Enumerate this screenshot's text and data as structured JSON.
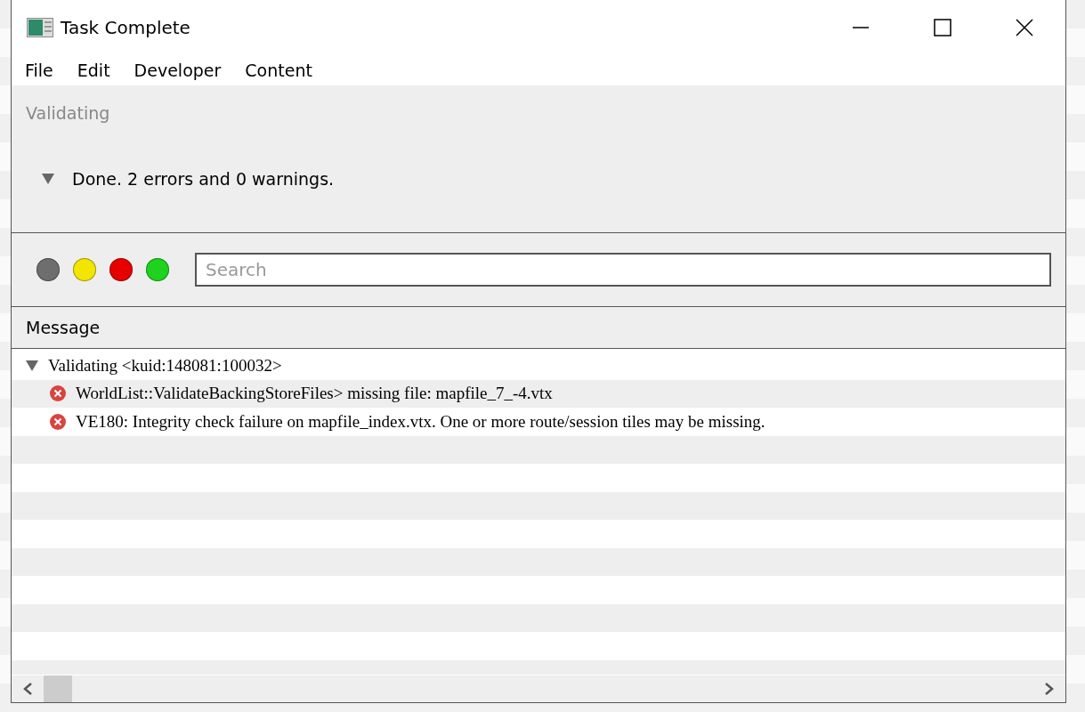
{
  "window": {
    "title": "Task Complete"
  },
  "menu": [
    "File",
    "Edit",
    "Developer",
    "Content"
  ],
  "progress": {
    "title": "Validating",
    "summary": "Done. 2 errors and 0 warnings.",
    "expanded": true
  },
  "filters": [
    {
      "color": "#6e6e6e"
    },
    {
      "color": "#f2e600"
    },
    {
      "color": "#e60000"
    },
    {
      "color": "#1ed21e"
    }
  ],
  "search": {
    "placeholder": "Search"
  },
  "table": {
    "columns": [
      "Message"
    ],
    "rows": [
      {
        "text": "Validating <kuid:148081:100032>",
        "expanded": true,
        "children": [
          {
            "kind": "error",
            "text": "WorldList::ValidateBackingStoreFiles> missing file: mapfile_7_-4.vtx"
          },
          {
            "kind": "error",
            "text": "VE180: Integrity check failure on mapfile_index.vtx. One or more route/session tiles may be missing."
          }
        ]
      }
    ]
  }
}
